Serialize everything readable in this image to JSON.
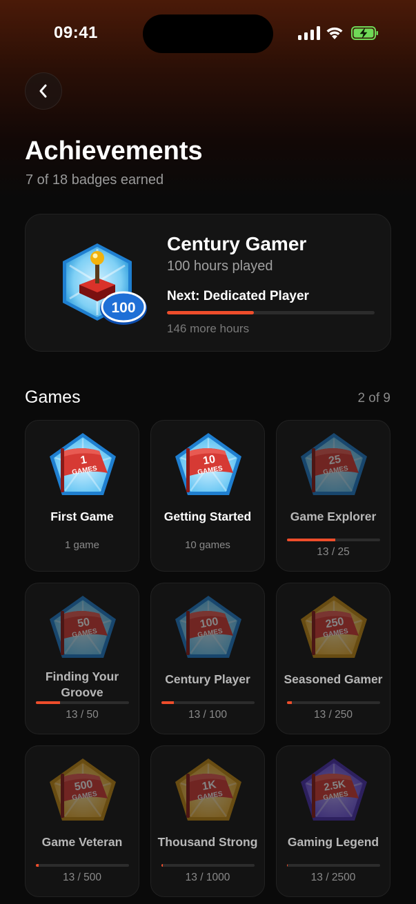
{
  "status_bar": {
    "time": "09:41"
  },
  "header": {
    "title": "Achievements",
    "subtitle": "7 of 18 badges earned"
  },
  "featured": {
    "name": "Century Gamer",
    "description": "100 hours played",
    "badge_number": "100",
    "next_label": "Next: Dedicated Player",
    "progress": 0.42,
    "remaining": "146 more hours"
  },
  "section": {
    "title": "Games",
    "count": "2 of 9"
  },
  "badges": [
    {
      "name": "First Game",
      "number": "1",
      "unit": "GAMES",
      "requirement": "1 game",
      "earned": true,
      "tier": "blue"
    },
    {
      "name": "Getting Started",
      "number": "10",
      "unit": "GAMES",
      "requirement": "10 games",
      "earned": true,
      "tier": "blue"
    },
    {
      "name": "Game Explorer",
      "number": "25",
      "unit": "GAMES",
      "progress_text": "13 / 25",
      "progress": 0.52,
      "earned": false,
      "tier": "blue"
    },
    {
      "name": "Finding Your Groove",
      "number": "50",
      "unit": "GAMES",
      "progress_text": "13 / 50",
      "progress": 0.26,
      "earned": false,
      "tier": "blue"
    },
    {
      "name": "Century Player",
      "number": "100",
      "unit": "GAMES",
      "progress_text": "13 / 100",
      "progress": 0.13,
      "earned": false,
      "tier": "blue"
    },
    {
      "name": "Seasoned Gamer",
      "number": "250",
      "unit": "GAMES",
      "progress_text": "13 / 250",
      "progress": 0.052,
      "earned": false,
      "tier": "gold"
    },
    {
      "name": "Game Veteran",
      "number": "500",
      "unit": "GAMES",
      "progress_text": "13 / 500",
      "progress": 0.026,
      "earned": false,
      "tier": "gold"
    },
    {
      "name": "Thousand Strong",
      "number": "1K",
      "unit": "GAMES",
      "progress_text": "13 / 1000",
      "progress": 0.013,
      "earned": false,
      "tier": "gold"
    },
    {
      "name": "Gaming Legend",
      "number": "2.5K",
      "unit": "GAMES",
      "progress_text": "13 / 2500",
      "progress": 0.0052,
      "earned": false,
      "tier": "purple"
    }
  ],
  "colors": {
    "accent": "#ee4d2b",
    "background": "#0a0a0a",
    "card": "#131313",
    "battery": "#6fd957"
  }
}
